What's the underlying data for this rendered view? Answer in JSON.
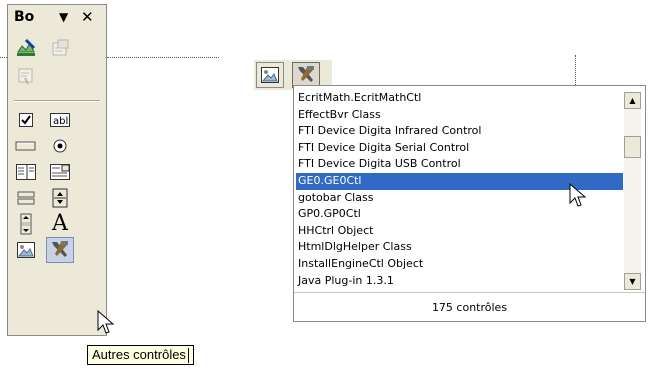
{
  "toolbox": {
    "title": "Bo",
    "menu_glyph": "▼",
    "close_glyph": "✕",
    "tools": [
      {
        "icon": "design-mode-icon"
      },
      {
        "icon": "properties-icon"
      },
      {
        "icon": "view-code-icon"
      },
      {
        "icon": "checkbox-icon"
      },
      {
        "icon": "textbox-icon"
      },
      {
        "icon": "command-button-icon"
      },
      {
        "icon": "option-button-icon"
      },
      {
        "icon": "listbox-icon"
      },
      {
        "icon": "combobox-icon"
      },
      {
        "icon": "toggle-button-icon"
      },
      {
        "icon": "spin-button-icon"
      },
      {
        "icon": "scrollbar-icon"
      },
      {
        "icon": "label-icon",
        "glyph": "A"
      },
      {
        "icon": "image-icon"
      },
      {
        "icon": "more-controls-icon"
      }
    ]
  },
  "tooltip": {
    "text": "Autres contrôles"
  },
  "mini_toolbar": {
    "buttons": [
      {
        "icon": "image-icon"
      },
      {
        "icon": "more-controls-icon"
      }
    ]
  },
  "dropdown": {
    "items": [
      "EcritMath.EcritMathCtl",
      "EffectBvr Class",
      "FTI Device Digita Infrared Control",
      "FTI Device Digita Serial Control",
      "FTI Device Digita USB Control",
      "GE0.GE0Ctl",
      "gotobar Class",
      "GP0.GP0Ctl",
      "HHCtrl Object",
      "HtmlDlgHelper Class",
      "InstallEngineCtl Object",
      "Java Plug-in 1.3.1"
    ],
    "selected_index": 5,
    "count_label": "175 contrôles",
    "up_arrow": "▲",
    "down_arrow": "▼"
  },
  "colors": {
    "selection": "#316ac5",
    "panel": "#ece9d8",
    "tooltip_bg": "#ffffe1"
  }
}
